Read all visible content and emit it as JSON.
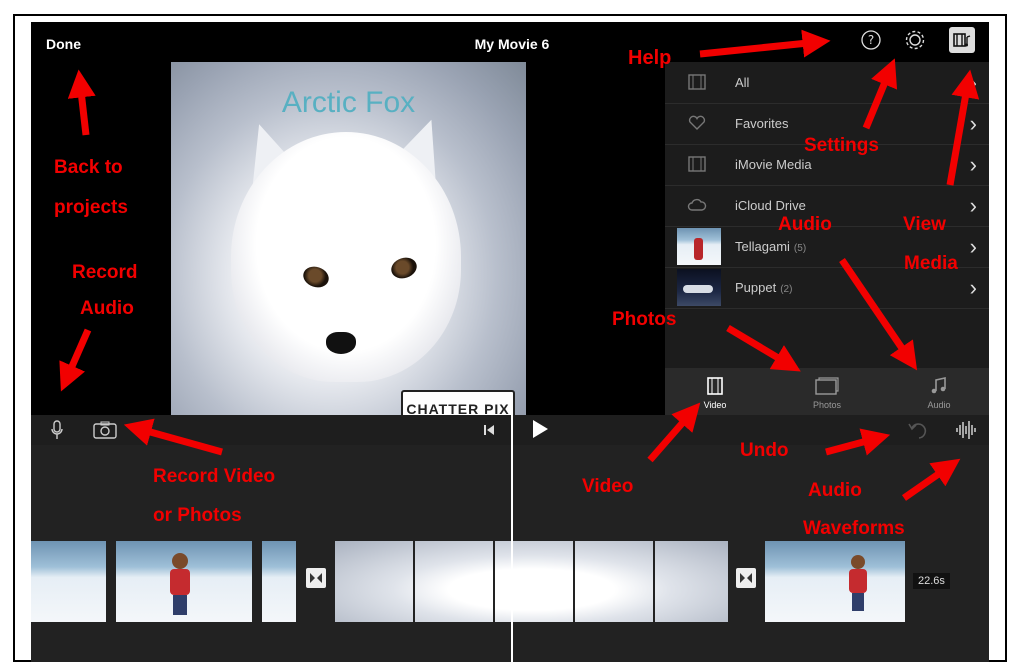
{
  "topbar": {
    "done_label": "Done",
    "project_title": "My Movie 6"
  },
  "viewer": {
    "overlay_title": "Arctic Fox",
    "watermark": "CHATTER PIX"
  },
  "media_browser": {
    "items": [
      {
        "label": "All",
        "icon": "film-icon"
      },
      {
        "label": "Favorites",
        "icon": "heart-icon"
      },
      {
        "label": "iMovie Media",
        "icon": "film-icon"
      },
      {
        "label": "iCloud Drive",
        "icon": "cloud-icon"
      },
      {
        "label": "Tellagami",
        "count": "(5)",
        "icon": "thumbnail"
      },
      {
        "label": "Puppet",
        "count": "(2)",
        "icon": "thumbnail"
      }
    ],
    "tabs": [
      {
        "label": "Video",
        "icon": "video-icon",
        "active": true
      },
      {
        "label": "Photos",
        "icon": "photos-icon",
        "active": false
      },
      {
        "label": "Audio",
        "icon": "music-note-icon",
        "active": false
      }
    ]
  },
  "timeline": {
    "duration_badge": "22.6s"
  },
  "annotations": {
    "help": "Help",
    "back_line1": "Back to",
    "back_line2": "projects",
    "record_audio_line1": "Record",
    "record_audio_line2": "Audio",
    "settings": "Settings",
    "audio": "Audio",
    "view_line1": "View",
    "view_line2": "Media",
    "photos": "Photos",
    "record_video_line1": "Record Video",
    "record_video_line2": "or Photos",
    "video": "Video",
    "undo": "Undo",
    "waveforms_line1": "Audio",
    "waveforms_line2": "Waveforms"
  },
  "colors": {
    "annotation": "#f20000",
    "app_background": "#000000",
    "viewer_title": "#58b0c2"
  }
}
